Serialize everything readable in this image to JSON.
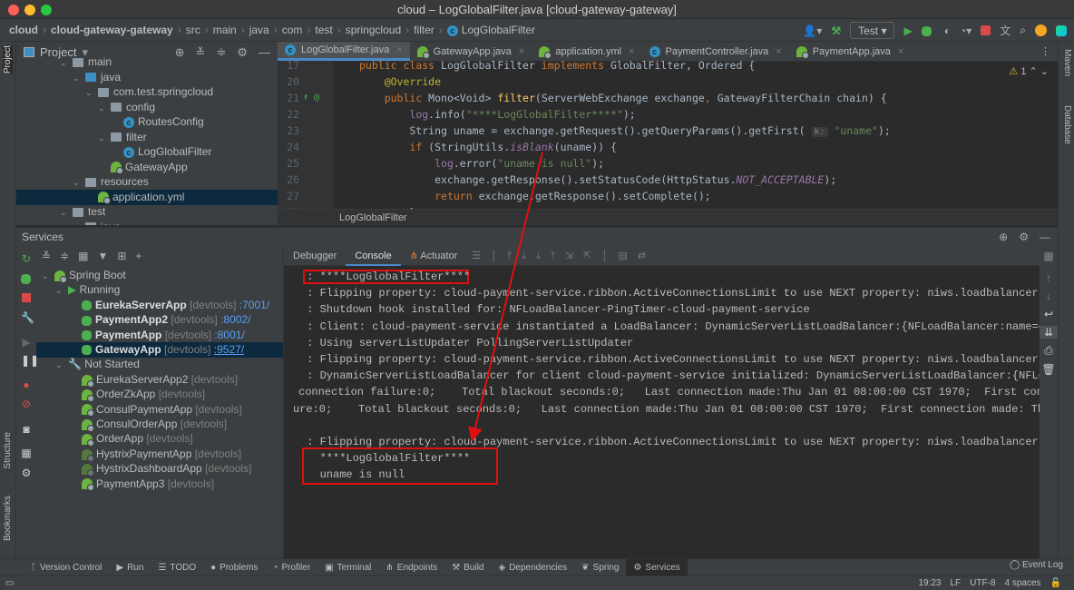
{
  "window": {
    "title": "cloud – LogGlobalFilter.java [cloud-gateway-gateway]"
  },
  "breadcrumb": [
    "cloud",
    "cloud-gateway-gateway",
    "src",
    "main",
    "java",
    "com",
    "test",
    "springcloud",
    "filter",
    "LogGlobalFilter"
  ],
  "toolbar": {
    "run_config": "Test"
  },
  "left_strip": {
    "project": "Project",
    "structure": "Structure",
    "bookmarks": "Bookmarks"
  },
  "right_strip": {
    "maven": "Maven",
    "database": "Database"
  },
  "project": {
    "title": "Project",
    "items": [
      {
        "label": "main",
        "indent": 4,
        "icon": "folder"
      },
      {
        "label": "java",
        "indent": 5,
        "icon": "folder-source"
      },
      {
        "label": "com.test.springcloud",
        "indent": 6,
        "icon": "package"
      },
      {
        "label": "config",
        "indent": 7,
        "icon": "package"
      },
      {
        "label": "RoutesConfig",
        "indent": 8,
        "icon": "class"
      },
      {
        "label": "filter",
        "indent": 7,
        "icon": "package"
      },
      {
        "label": "LogGlobalFilter",
        "indent": 8,
        "icon": "class"
      },
      {
        "label": "GatewayApp",
        "indent": 7,
        "icon": "spring-class"
      },
      {
        "label": "resources",
        "indent": 5,
        "icon": "folder-resources"
      },
      {
        "label": "application.yml",
        "indent": 6,
        "icon": "spring-yml",
        "selected": true
      },
      {
        "label": "test",
        "indent": 4,
        "icon": "folder"
      },
      {
        "label": "java",
        "indent": 5,
        "icon": "folder"
      }
    ]
  },
  "editor": {
    "tabs": [
      {
        "label": "LogGlobalFilter.java",
        "icon": "class",
        "active": true
      },
      {
        "label": "GatewayApp.java",
        "icon": "spring-class"
      },
      {
        "label": "application.yml",
        "icon": "spring-yml"
      },
      {
        "label": "PaymentController.java",
        "icon": "class"
      },
      {
        "label": "PaymentApp.java",
        "icon": "spring-class"
      }
    ],
    "warnings": "1",
    "lines": [
      {
        "n": "17",
        "tokens": [
          {
            "t": "public class ",
            "c": "kw"
          },
          {
            "t": "LogGlobalFilter ",
            "c": "tx"
          },
          {
            "t": "implements ",
            "c": "kw"
          },
          {
            "t": "GlobalFilter, Ordered {",
            "c": "tx"
          }
        ]
      },
      {
        "n": "20",
        "tokens": [
          {
            "t": "    @Override",
            "c": "an"
          }
        ]
      },
      {
        "n": "21",
        "tokens": [
          {
            "t": "    public ",
            "c": "kw"
          },
          {
            "t": "Mono<Void> ",
            "c": "tx"
          },
          {
            "t": "filter",
            "c": "me"
          },
          {
            "t": "(ServerWebExchange exchange",
            "c": "tx"
          },
          {
            "t": ", ",
            "c": "kw"
          },
          {
            "t": "GatewayFilterChain chain) {",
            "c": "tx"
          }
        ]
      },
      {
        "n": "22",
        "tokens": [
          {
            "t": "        ",
            "c": "tx"
          },
          {
            "t": "log",
            "c": "fi"
          },
          {
            "t": ".info(",
            "c": "tx"
          },
          {
            "t": "\"****LogGlobalFilter****\"",
            "c": "st"
          },
          {
            "t": ");",
            "c": "tx"
          }
        ]
      },
      {
        "n": "23",
        "tokens": [
          {
            "t": "        String uname = exchange.getRequest().getQueryParams().getFirst( ",
            "c": "tx"
          },
          {
            "t": "k:",
            "c": "hint"
          },
          {
            "t": " \"uname\"",
            "c": "st"
          },
          {
            "t": ");",
            "c": "tx"
          }
        ]
      },
      {
        "n": "24",
        "tokens": [
          {
            "t": "        ",
            "c": "tx"
          },
          {
            "t": "if ",
            "c": "kw"
          },
          {
            "t": "(StringUtils.",
            "c": "tx"
          },
          {
            "t": "isBlank",
            "c": "it"
          },
          {
            "t": "(uname)) {",
            "c": "tx"
          }
        ]
      },
      {
        "n": "25",
        "tokens": [
          {
            "t": "            ",
            "c": "tx"
          },
          {
            "t": "log",
            "c": "fi"
          },
          {
            "t": ".error(",
            "c": "tx"
          },
          {
            "t": "\"uname is null\"",
            "c": "st"
          },
          {
            "t": ");",
            "c": "tx"
          }
        ]
      },
      {
        "n": "26",
        "tokens": [
          {
            "t": "            exchange.getResponse().setStatusCode(HttpStatus.",
            "c": "tx"
          },
          {
            "t": "NOT_ACCEPTABLE",
            "c": "it"
          },
          {
            "t": ");",
            "c": "tx"
          }
        ]
      },
      {
        "n": "27",
        "tokens": [
          {
            "t": "            ",
            "c": "tx"
          },
          {
            "t": "return ",
            "c": "kw"
          },
          {
            "t": "exchange.getResponse().setComplete();",
            "c": "tx"
          }
        ]
      },
      {
        "n": "28",
        "tokens": [
          {
            "t": "        }",
            "c": "tx"
          }
        ]
      }
    ],
    "breadcrumb": "LogGlobalFilter"
  },
  "services": {
    "title": "Services",
    "tree": [
      {
        "label": "Spring Boot",
        "level": 0,
        "icon": "spring",
        "kind": "group"
      },
      {
        "label": "Running",
        "level": 1,
        "icon": "run",
        "kind": "group"
      },
      {
        "label": "EurekaServerApp",
        "tag": "[devtools]",
        "port": ":7001/",
        "level": 2,
        "icon": "debug",
        "bold": true
      },
      {
        "label": "PaymentApp2",
        "tag": "[devtools]",
        "port": ":8002/",
        "level": 2,
        "icon": "debug",
        "bold": true
      },
      {
        "label": "PaymentApp",
        "tag": "[devtools]",
        "port": ":8001/",
        "level": 2,
        "icon": "debug",
        "bold": true
      },
      {
        "label": "GatewayApp",
        "tag": "[devtools]",
        "port": ":9527/",
        "level": 2,
        "icon": "debug",
        "bold": true,
        "selected": true
      },
      {
        "label": "Not Started",
        "level": 1,
        "icon": "wrench",
        "kind": "group"
      },
      {
        "label": "EurekaServerApp2",
        "tag": "[devtools]",
        "level": 2,
        "icon": "spring"
      },
      {
        "label": "OrderZkApp",
        "tag": "[devtools]",
        "level": 2,
        "icon": "spring"
      },
      {
        "label": "ConsulPaymentApp",
        "tag": "[devtools]",
        "level": 2,
        "icon": "spring"
      },
      {
        "label": "ConsulOrderApp",
        "tag": "[devtools]",
        "level": 2,
        "icon": "spring"
      },
      {
        "label": "OrderApp",
        "tag": "[devtools]",
        "level": 2,
        "icon": "spring"
      },
      {
        "label": "HystrixPaymentApp",
        "tag": "[devtools]",
        "level": 2,
        "icon": "spring-dim"
      },
      {
        "label": "HystrixDashboardApp",
        "tag": "[devtools]",
        "level": 2,
        "icon": "spring-dim"
      },
      {
        "label": "PaymentApp3",
        "tag": "[devtools]",
        "level": 2,
        "icon": "spring"
      }
    ],
    "console_tabs": [
      {
        "label": "Debugger"
      },
      {
        "label": "Console",
        "active": true
      },
      {
        "label": "Actuator"
      }
    ],
    "console_lines": [
      " : ****LogGlobalFilter****",
      " : Flipping property: cloud-payment-service.ribbon.ActiveConnectionsLimit to use NEXT property: niws.loadbalancer.availabilityFi",
      " : Shutdown hook installed for: NFLoadBalancer-PingTimer-cloud-payment-service",
      " : Client: cloud-payment-service instantiated a LoadBalancer: DynamicServerListLoadBalancer:{NFLoadBalancer:name=cloud-payment-s",
      " : Using serverListUpdater PollingServerListUpdater",
      " : Flipping property: cloud-payment-service.ribbon.ActiveConnectionsLimit to use NEXT property: niws.loadbalancer.availabilityFi",
      " : DynamicServerListLoadBalancer for client cloud-payment-service initialized: DynamicServerListLoadBalancer:{NFLoadBalancer:nam",
      "connection failure:0;    Total blackout seconds:0;   Last connection made:Thu Jan 01 08:00:00 CST 1970;  First connection made:",
      "ure:0;    Total blackout seconds:0;   Last connection made:Thu Jan 01 08:00:00 CST 1970;  First connection made: Thu Jan 01 08:0",
      "",
      " : Flipping property: cloud-payment-service.ribbon.ActiveConnectionsLimit to use NEXT property: niws.loadbalancer.availabilityFi",
      "   ****LogGlobalFilter****",
      "   uname is null"
    ]
  },
  "toolwindows": [
    {
      "label": "Version Control",
      "icon": "vcs-icon"
    },
    {
      "label": "Run",
      "icon": "run-icon"
    },
    {
      "label": "TODO",
      "icon": "todo-icon"
    },
    {
      "label": "Problems",
      "icon": "problems-icon"
    },
    {
      "label": "Profiler",
      "icon": "profiler-icon"
    },
    {
      "label": "Terminal",
      "icon": "terminal-icon"
    },
    {
      "label": "Endpoints",
      "icon": "endpoints-icon"
    },
    {
      "label": "Build",
      "icon": "build-icon"
    },
    {
      "label": "Dependencies",
      "icon": "dependencies-icon"
    },
    {
      "label": "Spring",
      "icon": "spring-icon"
    },
    {
      "label": "Services",
      "icon": "services-icon",
      "active": true
    }
  ],
  "event_log": "Event Log",
  "status": {
    "position": "19:23",
    "line_sep": "LF",
    "encoding": "UTF-8",
    "indent": "4 spaces"
  },
  "colors": {
    "accent": "#4a88c7",
    "annotation_box": "#e01010",
    "spring": "#6db33f",
    "selection": "#0d293e"
  }
}
